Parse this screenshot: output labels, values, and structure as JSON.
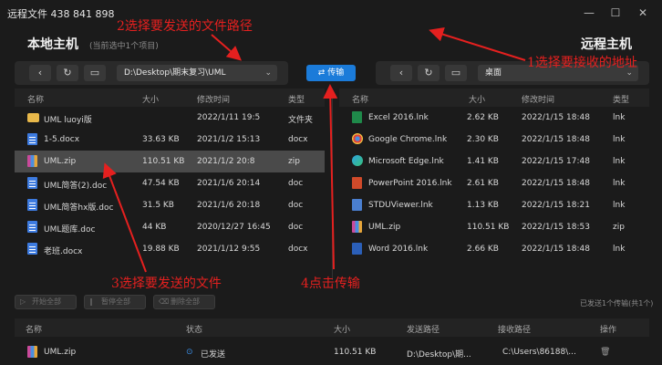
{
  "window": {
    "title": "远程文件 438 841 898",
    "controls": [
      "—",
      "☐",
      "✕"
    ]
  },
  "local": {
    "title": "本地主机",
    "subtitle": "(当前选中1个项目)",
    "path": "D:\\Desktop\\期末复习\\UML",
    "columns": [
      "名称",
      "大小",
      "修改时间",
      "类型"
    ],
    "rows": [
      {
        "icon": "folder",
        "name": "UML  luoyi版",
        "size": "",
        "date": "2022/1/11 19:5",
        "type": "文件夹"
      },
      {
        "icon": "doc",
        "name": "1-5.docx",
        "size": "33.63 KB",
        "date": "2021/1/2 15:13",
        "type": "docx"
      },
      {
        "icon": "zip",
        "name": "UML.zip",
        "size": "110.51 KB",
        "date": "2021/1/2 20:8",
        "type": "zip"
      },
      {
        "icon": "doc",
        "name": "UML简答(2).doc",
        "size": "47.54 KB",
        "date": "2021/1/6 20:14",
        "type": "doc"
      },
      {
        "icon": "doc",
        "name": "UML简答hx版.doc",
        "size": "31.5 KB",
        "date": "2021/1/6 20:18",
        "type": "doc"
      },
      {
        "icon": "doc",
        "name": "UML题库.doc",
        "size": "44 KB",
        "date": "2020/12/27 16:45",
        "type": "doc"
      },
      {
        "icon": "doc",
        "name": "老班.docx",
        "size": "19.88 KB",
        "date": "2021/1/12 9:55",
        "type": "docx"
      }
    ]
  },
  "send_button": "传输",
  "remote": {
    "title": "远程主机",
    "path": "桌面",
    "columns": [
      "名称",
      "大小",
      "修改时间",
      "类型"
    ],
    "rows": [
      {
        "icon": "lnk-xl",
        "name": "Excel 2016.lnk",
        "size": "2.62 KB",
        "date": "2022/1/15 18:48",
        "type": "lnk"
      },
      {
        "icon": "lnk-ch",
        "name": "Google Chrome.lnk",
        "size": "2.30 KB",
        "date": "2022/1/15 18:48",
        "type": "lnk"
      },
      {
        "icon": "lnk-edge",
        "name": "Microsoft Edge.lnk",
        "size": "1.41 KB",
        "date": "2022/1/15 17:48",
        "type": "lnk"
      },
      {
        "icon": "lnk-pp",
        "name": "PowerPoint 2016.lnk",
        "size": "2.61 KB",
        "date": "2022/1/15 18:48",
        "type": "lnk"
      },
      {
        "icon": "lnk-stdu",
        "name": "STDUViewer.lnk",
        "size": "1.13 KB",
        "date": "2022/1/15 18:21",
        "type": "lnk"
      },
      {
        "icon": "zip",
        "name": "UML.zip",
        "size": "110.51 KB",
        "date": "2022/1/15 18:53",
        "type": "zip"
      },
      {
        "icon": "lnk-wd",
        "name": "Word 2016.lnk",
        "size": "2.66 KB",
        "date": "2022/1/15 18:48",
        "type": "lnk"
      }
    ]
  },
  "transfer": {
    "start_all": "开始全部",
    "pause_all": "暂停全部",
    "delete_all": "删除全部",
    "sent_count": "已发送1个传输(共1个)",
    "columns": [
      "名称",
      "状态",
      "大小",
      "发送路径",
      "接收路径",
      "操作"
    ],
    "rows": [
      {
        "name": "UML.zip",
        "status": "已发送",
        "size": "110.51 KB",
        "from": "D:\\Desktop\\期...",
        "to": "C:\\Users\\86188\\..."
      }
    ]
  },
  "annotations": {
    "step1": "1选择要接收的地址",
    "step2": "2选择要发送的文件路径",
    "step3": "3选择要发送的文件",
    "step4": "4点击传输"
  },
  "colors": {
    "accent": "#1b7bd9",
    "annotation": "#e5201f",
    "selected_row": "#4a4a4a"
  }
}
